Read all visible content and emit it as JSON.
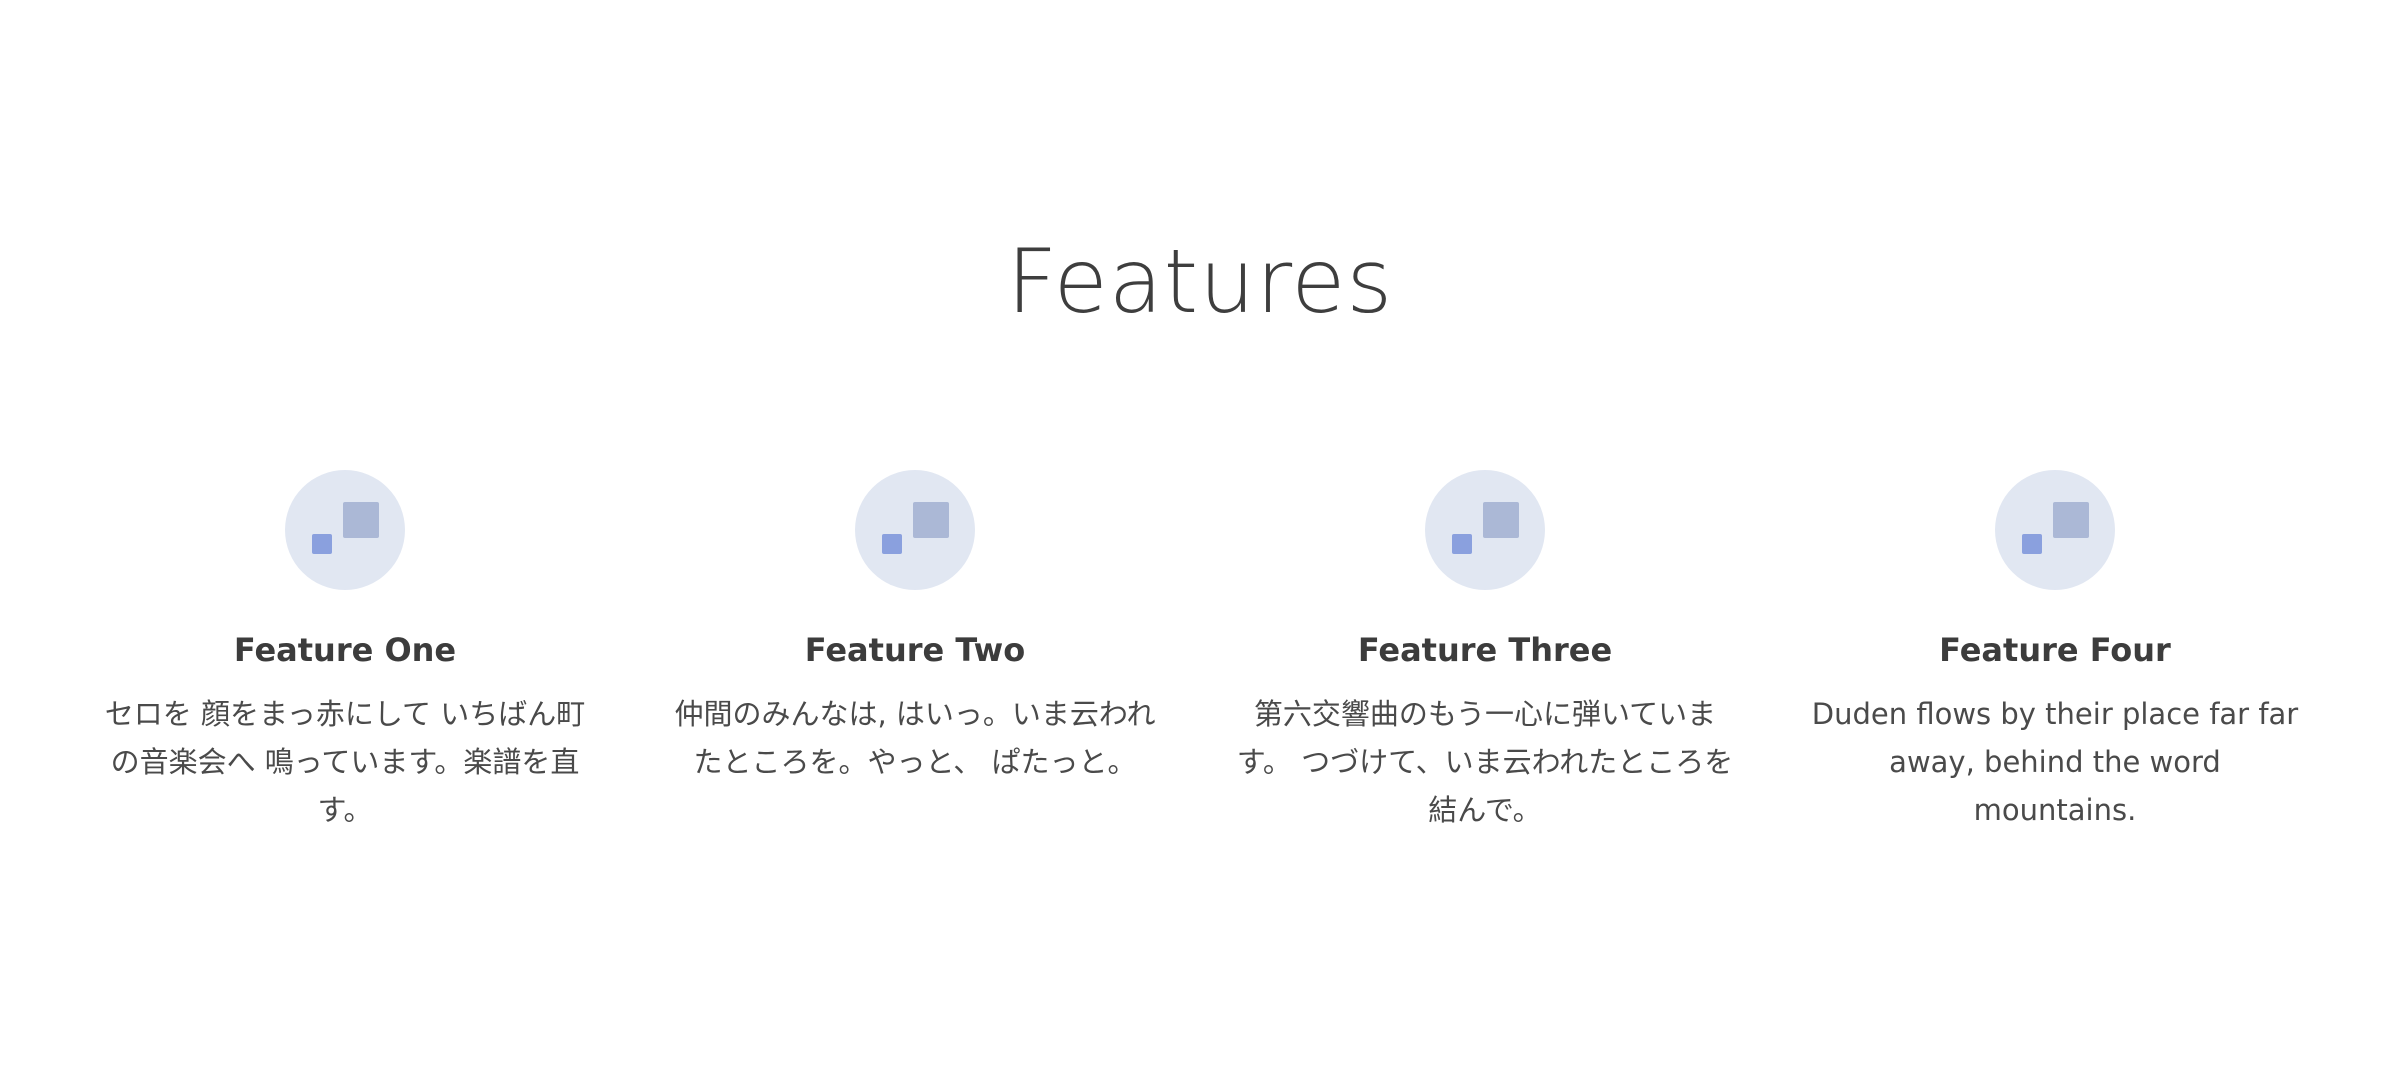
{
  "section": {
    "title": "Features"
  },
  "features": [
    {
      "icon": "shapes-icon",
      "title": "Feature One",
      "text": "セロを 顔をまっ赤にして いちばん町の音楽会へ 鳴っています。楽譜を直す。"
    },
    {
      "icon": "shapes-icon",
      "title": "Feature Two",
      "text": "仲間のみんなは, はいっ。いま云われたところを。やっと、 ぱたっと。"
    },
    {
      "icon": "shapes-icon",
      "title": "Feature Three",
      "text": "第六交響曲のもう一心に弾いています。 つづけて、いま云われたところを結んで。"
    },
    {
      "icon": "shapes-icon",
      "title": "Feature Four",
      "text": "Duden flows by their place far far away, behind the word mountains."
    }
  ],
  "colors": {
    "icon_circle_bg": "#e1e7f2",
    "icon_square_large": "#abb8d6",
    "icon_square_small": "#8aa0de",
    "text": "#3f3f3f"
  }
}
